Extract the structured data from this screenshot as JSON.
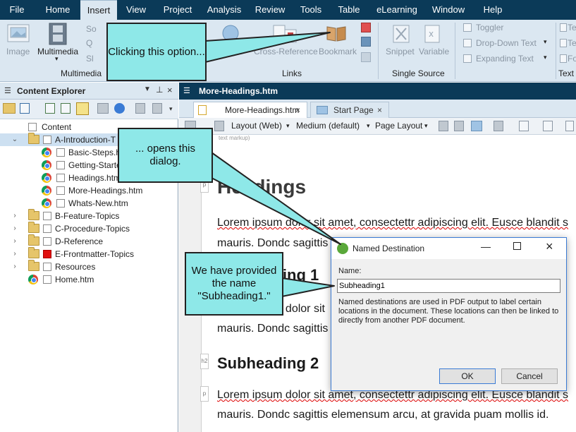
{
  "menubar": {
    "items": [
      "File",
      "Home",
      "Insert",
      "View",
      "Project",
      "Analysis",
      "Review",
      "Tools",
      "Table",
      "eLearning",
      "Window",
      "Help"
    ],
    "active": "Insert"
  },
  "ribbon": {
    "image_label": "Image",
    "multimedia_label": "Multimedia",
    "multimedia_group": "Multimedia",
    "partial_so": "So",
    "partial_q": "Q",
    "partial_sl": "Sl",
    "partial_nk": "nk",
    "cross_reference_label": "Cross-Reference",
    "bookmark_label": "Bookmark",
    "links_group": "Links",
    "snippet_label": "Snippet",
    "variable_label": "Variable",
    "single_source_group": "Single Source",
    "toggler_label": "Toggler",
    "dropdown_text_label": "Drop-Down Text",
    "expanding_text_label": "Expanding Text",
    "partial_te1": "Te",
    "partial_te2": "Te",
    "partial_fo": "Fo",
    "text_group": "Text"
  },
  "content_explorer": {
    "title": "Content Explorer",
    "tree": [
      {
        "label": "Content"
      },
      {
        "label": "A-Introduction-T"
      },
      {
        "label": "Basic-Steps.h"
      },
      {
        "label": "Getting-Starte"
      },
      {
        "label": "Headings.htm"
      },
      {
        "label": "More-Headings.htm"
      },
      {
        "label": "Whats-New.htm"
      },
      {
        "label": "B-Feature-Topics"
      },
      {
        "label": "C-Procedure-Topics"
      },
      {
        "label": "D-Reference"
      },
      {
        "label": "E-Frontmatter-Topics"
      },
      {
        "label": "Resources"
      },
      {
        "label": "Home.htm"
      }
    ]
  },
  "editor": {
    "window_title": "More-Headings.htm",
    "tabs": [
      {
        "label": "More-Headings.htm"
      },
      {
        "label": "Start Page"
      }
    ],
    "toolbar": {
      "layout": "Layout (Web)",
      "medium": "Medium (default)",
      "page_layout": "Page Layout"
    },
    "markup_hint": "text markup)",
    "heading1": "Headings",
    "para1_line1": "Lorem ipsum dolor sit amet, consectettr adipiscing elit. Eusce blandit s",
    "para1_line2": "mauris. Dondc sagittis",
    "heading2_partial": "Subheading 1",
    "para2_line1": "Lorem ipsum dolor sit",
    "para2_line2": "mauris. Dondc sagittis",
    "heading3": "Subheading 2",
    "para3_line1": "Lorem ipsum dolor sit amet, consectettr adipiscing elit. Eusce blandit s",
    "para3_line2": "mauris. Dondc sagittis elemensum arcu, at gravida puam mollis id.",
    "gutter_marks": [
      "p",
      "h1",
      "p",
      "h2",
      "p"
    ]
  },
  "dialog": {
    "title": "Named Destination",
    "name_label": "Name:",
    "name_value": "Subheading1",
    "description": "Named destinations are used in PDF output to label certain locations in the document. These locations can then be linked to directly from another PDF document.",
    "ok_label": "OK",
    "cancel_label": "Cancel"
  },
  "callouts": {
    "first": "Clicking this option...",
    "second": "... opens this dialog.",
    "third": "We have provided the name \"Subheading1.\""
  },
  "colors": {
    "menubar_bg": "#0b3a58",
    "ribbon_bg": "#dbe7f1",
    "callout_bg": "#8ee8e8",
    "selected_row": "#cde0f1"
  }
}
